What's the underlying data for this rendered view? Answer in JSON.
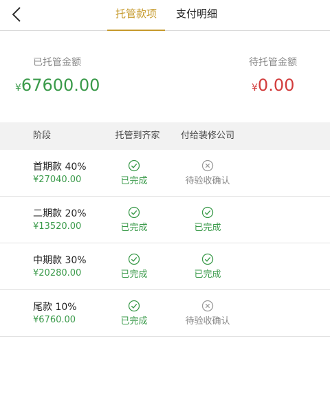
{
  "header": {
    "back_icon": "chevron-left-icon",
    "tabs": [
      {
        "label": "托管款项",
        "active": true
      },
      {
        "label": "支付明细",
        "active": false
      }
    ]
  },
  "summary": {
    "hosted_label": "已托管金额",
    "hosted_currency": "¥",
    "hosted_amount": "67600.00",
    "pending_label": "待托管金额",
    "pending_currency": "¥",
    "pending_amount": "0.00"
  },
  "table": {
    "headers": [
      "阶段",
      "托管到齐家",
      "付给装修公司"
    ],
    "rows": [
      {
        "stage": "首期款 40%",
        "amount": "¥27040.00",
        "escrow": {
          "icon": "check-circle-icon",
          "text": "已完成"
        },
        "payout": {
          "icon": "x-circle-icon",
          "text": "待验收确认"
        }
      },
      {
        "stage": "二期款 20%",
        "amount": "¥13520.00",
        "escrow": {
          "icon": "check-circle-icon",
          "text": "已完成"
        },
        "payout": {
          "icon": "check-circle-icon",
          "text": "已完成"
        }
      },
      {
        "stage": "中期款 30%",
        "amount": "¥20280.00",
        "escrow": {
          "icon": "check-circle-icon",
          "text": "已完成"
        },
        "payout": {
          "icon": "check-circle-icon",
          "text": "已完成"
        }
      },
      {
        "stage": "尾款 10%",
        "amount": "¥6760.00",
        "escrow": {
          "icon": "check-circle-icon",
          "text": "已完成"
        },
        "payout": {
          "icon": "x-circle-icon",
          "text": "待验收确认"
        }
      }
    ]
  },
  "colors": {
    "accent": "#c69a2c",
    "green": "#3a9a4a",
    "red": "#d23c3c",
    "gray": "#888888"
  }
}
